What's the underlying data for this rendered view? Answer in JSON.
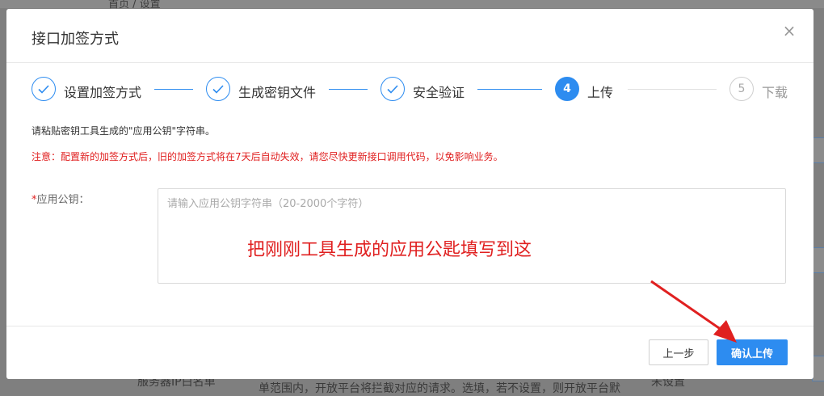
{
  "background": {
    "breadcrumb": "首页 / 设置",
    "bottom_left_text": "服务器IP白名单",
    "bottom_middle_text": "单范围内，开放平台将拦截对应的请求。选填，若不设置，则开放平台默",
    "bottom_right_text": "未设置"
  },
  "modal": {
    "title": "接口加签方式",
    "close": "×",
    "steps": [
      {
        "label": "设置加签方式",
        "status": "done"
      },
      {
        "label": "生成密钥文件",
        "status": "done"
      },
      {
        "label": "安全验证",
        "status": "done"
      },
      {
        "number": "4",
        "label": "上传",
        "status": "active"
      },
      {
        "number": "5",
        "label": "下载",
        "status": "pending"
      }
    ],
    "tip": "请粘贴密钥工具生成的\"应用公钥\"字符串。",
    "warning": "注意：配置新的加签方式后，旧的加签方式将在7天后自动失效，请您尽快更新接口调用代码，以免影响业务。",
    "field": {
      "required_mark": "*",
      "label": "应用公钥：",
      "placeholder": "请输入应用公钥字符串（20-2000个字符）"
    },
    "annotation": "把刚刚工具生成的应用公匙填写到这",
    "buttons": {
      "prev": "上一步",
      "confirm": "确认上传"
    }
  },
  "colors": {
    "primary": "#2d8cf0",
    "warning": "#e02020",
    "annotation_arrow": "#e02020"
  }
}
